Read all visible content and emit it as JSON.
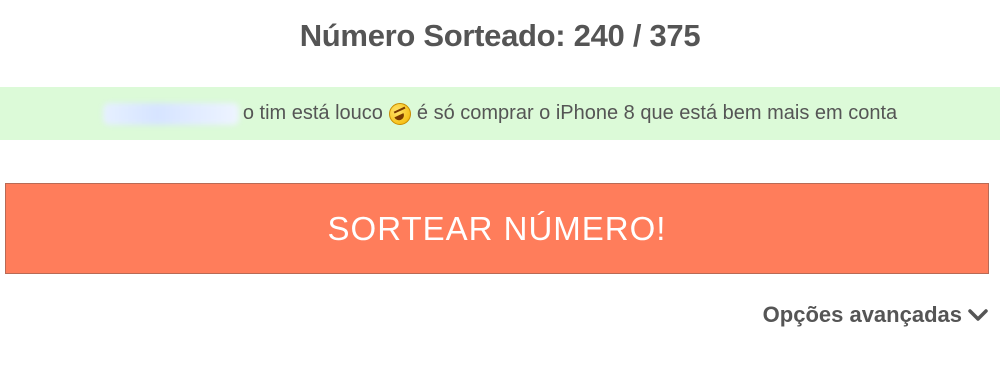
{
  "header": {
    "title_label": "Número Sorteado:",
    "drawn_number": "240",
    "separator": "/",
    "total": "375"
  },
  "comment": {
    "author_blurred": "",
    "text_before_emoji": "o tim está louco",
    "emoji": "rolling-on-floor-laughing-emoji",
    "text_after_emoji": "é só comprar o iPhone 8 que está bem mais em conta",
    "background": "#dcfad8"
  },
  "actions": {
    "draw_button_label": "SORTEAR NÚMERO!",
    "draw_button_color": "#ff7d5b",
    "advanced_options_label": "Opções avançadas",
    "advanced_options_icon": "chevron-down-icon"
  }
}
